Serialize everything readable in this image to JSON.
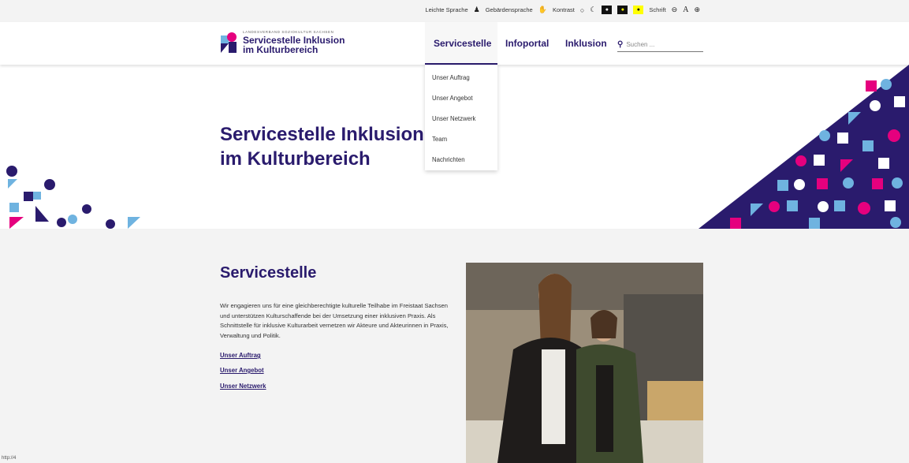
{
  "accessibility_bar": {
    "easy_language": "Leichte Sprache",
    "sign_language": "Gebärdensprache",
    "contrast_label": "Kontrast",
    "font_label": "Schrift",
    "font_symbol": "A"
  },
  "logo": {
    "subtitle": "LANDESVERBAND SOZIOKULTUR SACHSEN",
    "title_line1": "Servicestelle Inklusion",
    "title_line2": "im Kulturbereich"
  },
  "nav": {
    "items": [
      "Servicestelle",
      "Infoportal",
      "Inklusion"
    ],
    "search_placeholder": "Suchen ..."
  },
  "dropdown": {
    "items": [
      "Unser Auftrag",
      "Unser Angebot",
      "Unser Netzwerk",
      "Team",
      "Nachrichten"
    ]
  },
  "hero": {
    "title_line1": "Servicestelle Inklusion",
    "title_line2": "im Kulturbereich"
  },
  "section": {
    "title": "Servicestelle",
    "text": "Wir engagieren uns für eine gleichberechtigte kulturelle Teilhabe im Freistaat Sachsen und unterstützen Kulturschaffende bei der Umsetzung einer inklusiven Praxis. Als Schnittstelle für inklusive Kulturarbeit vernetzen wir Akteure und Akteurinnen in Praxis, Verwaltung und Politik.",
    "links": [
      "Unser Auftrag",
      "Unser Angebot",
      "Unser Netzwerk"
    ]
  },
  "status_url": "http://4",
  "colors": {
    "navy": "#2a1b6d",
    "pink": "#e5007e",
    "light_blue": "#6fb3e0",
    "background_gray": "#f3f3f3"
  }
}
